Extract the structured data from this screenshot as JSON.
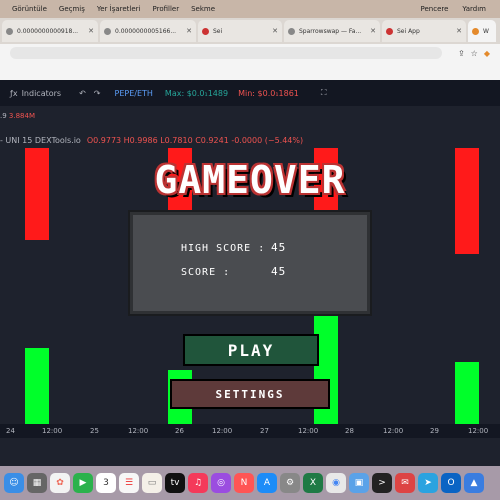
{
  "menubar": {
    "items": [
      "Görüntüle",
      "Geçmiş",
      "Yer İşaretleri",
      "Profiller",
      "Sekme"
    ],
    "right": [
      "Pencere",
      "Yardım"
    ]
  },
  "tabs": [
    {
      "label": "0.0000000000918..."
    },
    {
      "label": "0.0000000005166..."
    },
    {
      "label": "Sei"
    },
    {
      "label": "Sparrowswap — Fa..."
    },
    {
      "label": "Sei App"
    },
    {
      "label": "W"
    }
  ],
  "toolbar": {
    "indicators_label": "Indicators",
    "symbol": "PEPE/ETH",
    "max": "Max: $0.0₁1489",
    "min": "Min: $0.0₁1861"
  },
  "chart_info": {
    "volume_prefix": ".9",
    "volume": "3.884M",
    "source": "- UNI  15  DEXTools.io",
    "ohlc": "O0.9773 H0.9986 L0.7810 C0.9241 -0.0000 (−5.44%)"
  },
  "xaxis": {
    "labels": [
      "24",
      "12:00",
      "25",
      "12:00",
      "26",
      "12:00",
      "27",
      "12:00",
      "28",
      "12:00",
      "29",
      "12:00"
    ]
  },
  "game": {
    "title": "GAMEOVER",
    "high_score_label": "HIGH SCORE :",
    "high_score": "45",
    "score_label": "SCORE      :",
    "score": "45",
    "play_label": "PLAY",
    "settings_label": "SETTINGS"
  },
  "colors": {
    "pipe_red": "#ff1a1a",
    "pipe_green": "#00ff2a",
    "play_bg": "#20553b",
    "settings_bg": "#5e3a3a"
  }
}
